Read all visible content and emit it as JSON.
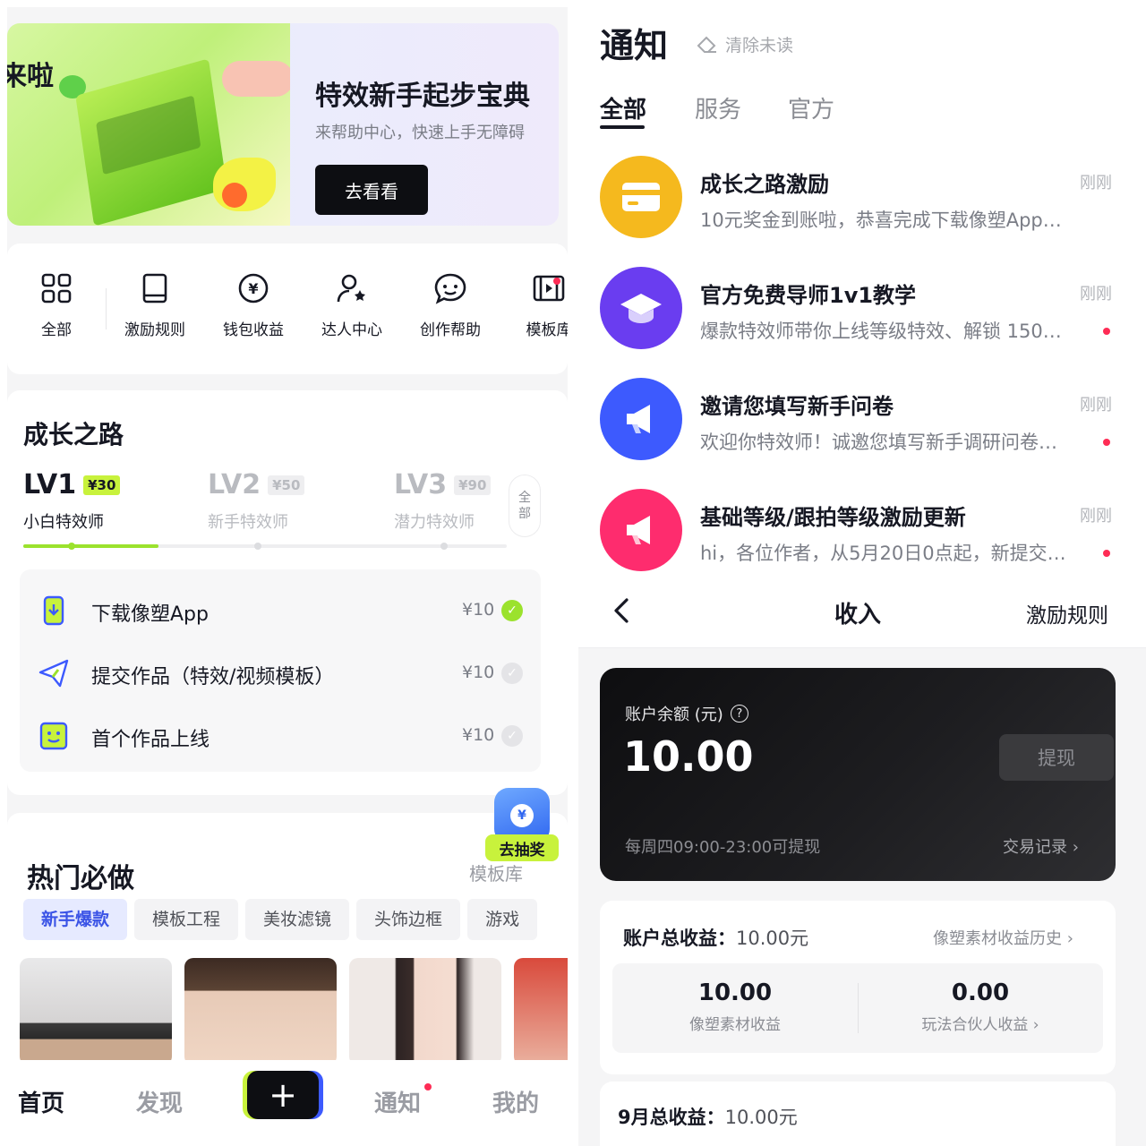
{
  "home": {
    "banner": {
      "art_text": "来啦",
      "title": "特效新手起步宝典",
      "subtitle": "来帮助中心，快速上手无障碍",
      "button": "去看看"
    },
    "quick_links": [
      {
        "label": "全部",
        "icon": "grid-icon"
      },
      {
        "label": "激励规则",
        "icon": "book-icon"
      },
      {
        "label": "钱包收益",
        "icon": "yen-circle-icon"
      },
      {
        "label": "达人中心",
        "icon": "user-star-icon"
      },
      {
        "label": "创作帮助",
        "icon": "help-chat-icon"
      },
      {
        "label": "模板库",
        "icon": "film-icon"
      }
    ],
    "growth": {
      "title": "成长之路",
      "levels": [
        {
          "name": "LV1",
          "reward": "¥30",
          "subtitle": "小白特效师",
          "active": true
        },
        {
          "name": "LV2",
          "reward": "¥50",
          "subtitle": "新手特效师",
          "active": false
        },
        {
          "name": "LV3",
          "reward": "¥90",
          "subtitle": "潜力特效师",
          "active": false
        }
      ],
      "all_label": "全部",
      "progress": 0.28,
      "tasks": [
        {
          "label": "下载像塑App",
          "amount": "¥10",
          "done": true,
          "icon": "phone-download-icon"
        },
        {
          "label": "提交作品（特效/视频模板）",
          "amount": "¥10",
          "done": false,
          "icon": "paper-plane-icon"
        },
        {
          "label": "首个作品上线",
          "amount": "¥10",
          "done": false,
          "icon": "smile-face-icon"
        }
      ]
    },
    "hot": {
      "title": "热门必做",
      "more": "模板库",
      "lottery": "去抽奖",
      "chips": [
        "新手爆款",
        "模板工程",
        "美妆滤镜",
        "头饰边框",
        "游戏"
      ],
      "active_chip": 0
    },
    "tabbar": {
      "home": "首页",
      "discover": "发现",
      "notify": "通知",
      "me": "我的"
    }
  },
  "notifications": {
    "title": "通知",
    "clear": "清除未读",
    "tabs": [
      "全部",
      "服务",
      "官方"
    ],
    "items": [
      {
        "title": "成长之路激励",
        "time": "刚刚",
        "message": "10元奖金到账啦，恭喜完成下载像塑App…",
        "unread": false,
        "color": "#f5b91e",
        "icon": "card-icon"
      },
      {
        "title": "官方免费导师1v1教学",
        "time": "刚刚",
        "message": "爆款特效师带你上线等级特效、解锁 150…",
        "unread": true,
        "color": "#6a3df0",
        "icon": "graduation-cap-icon"
      },
      {
        "title": "邀请您填写新手问卷",
        "time": "刚刚",
        "message": "欢迎你特效师！诚邀您填写新手调研问卷…",
        "unread": true,
        "color": "#3d5afe",
        "icon": "megaphone-icon"
      },
      {
        "title": "基础等级/跟拍等级激励更新",
        "time": "刚刚",
        "message": "hi，各位作者，从5月20日0点起，新提交…",
        "unread": true,
        "color": "#fe2c6e",
        "icon": "megaphone-icon"
      }
    ]
  },
  "income": {
    "title": "收入",
    "rules": "激励规则",
    "balance_label": "账户余额 (元)",
    "balance": "10.00",
    "withdraw": "提现",
    "withdraw_time": "每周四09:00-23:00可提现",
    "records": "交易记录 ›",
    "total_label": "账户总收益：",
    "total_value": "10.00元",
    "history": "像塑素材收益历史 ›",
    "breakdown": [
      {
        "value": "10.00",
        "label": "像塑素材收益"
      },
      {
        "value": "0.00",
        "label": "玩法合伙人收益 ›"
      }
    ],
    "month_label": "9月总收益：",
    "month_value": "10.00元"
  }
}
